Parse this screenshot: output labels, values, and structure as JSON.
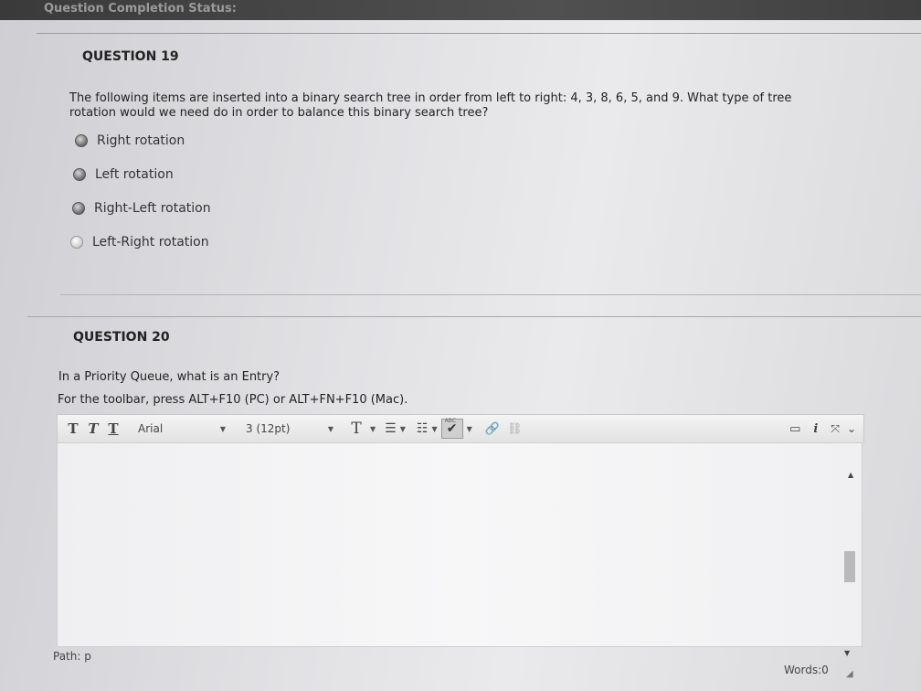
{
  "header": {
    "status": "Question Completion Status:"
  },
  "q19": {
    "heading": "QUESTION 19",
    "text_line1": "The following items are inserted into a binary search tree in order from left to right: 4, 3, 8, 6, 5, and 9. What type of tree",
    "text_line2": "rotation would we need do in order to balance this binary search tree?",
    "options": [
      "Right rotation",
      "Left rotation",
      "Right-Left rotation",
      "Left-Right rotation"
    ]
  },
  "q20": {
    "heading": "QUESTION 20",
    "text": "In a Priority Queue, what is an Entry?",
    "toolbar_hint": "For the toolbar, press ALT+F10 (PC) or ALT+FN+F10 (Mac).",
    "editor_value": ""
  },
  "toolbar": {
    "font_family": "Arial",
    "font_size": "3 (12pt)",
    "text_color": "T",
    "spell_label": "ABC",
    "icons": [
      "bold-t",
      "italic-t",
      "underline-t",
      "text-color",
      "bullet-list",
      "numbered-list",
      "spellcheck",
      "link",
      "unlink",
      "preview",
      "info",
      "fullscreen",
      "expand"
    ]
  },
  "editor_footer": {
    "path": "Path: p",
    "words": "Words:0"
  }
}
